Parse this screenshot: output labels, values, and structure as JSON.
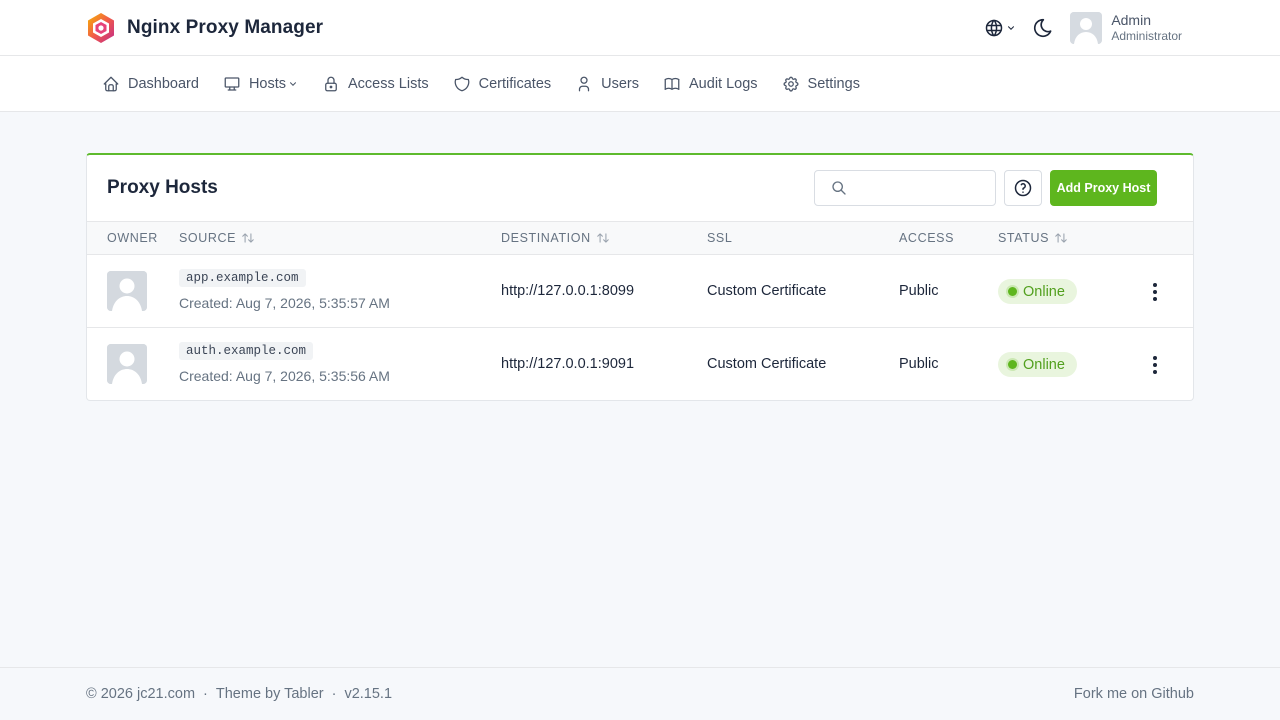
{
  "app": {
    "title": "Nginx Proxy Manager"
  },
  "user": {
    "name": "Admin",
    "role": "Administrator"
  },
  "nav": {
    "items": [
      {
        "label": "Dashboard",
        "icon": "home-icon"
      },
      {
        "label": "Hosts",
        "icon": "monitor-icon",
        "dropdown": true
      },
      {
        "label": "Access Lists",
        "icon": "lock-icon"
      },
      {
        "label": "Certificates",
        "icon": "shield-icon"
      },
      {
        "label": "Users",
        "icon": "user-icon"
      },
      {
        "label": "Audit Logs",
        "icon": "book-icon"
      },
      {
        "label": "Settings",
        "icon": "gear-icon"
      }
    ]
  },
  "card": {
    "title": "Proxy Hosts",
    "search_placeholder": "",
    "add_label": "Add Proxy Host",
    "accent_color": "#5eba2d"
  },
  "table": {
    "columns": {
      "owner": "OWNER",
      "source": "SOURCE",
      "destination": "DESTINATION",
      "ssl": "SSL",
      "access": "ACCESS",
      "status": "STATUS"
    },
    "rows": [
      {
        "domain": "app.example.com",
        "created": "Created: Aug 7, 2026, 5:35:57 AM",
        "destination": "http://127.0.0.1:8099",
        "ssl": "Custom Certificate",
        "access": "Public",
        "status": "Online"
      },
      {
        "domain": "auth.example.com",
        "created": "Created: Aug 7, 2026, 5:35:56 AM",
        "destination": "http://127.0.0.1:9091",
        "ssl": "Custom Certificate",
        "access": "Public",
        "status": "Online"
      }
    ]
  },
  "footer": {
    "copyright": "© 2026 jc21.com",
    "theme": "Theme by Tabler",
    "version": "v2.15.1",
    "fork": "Fork me on Github"
  },
  "colors": {
    "primary": "#5eb61e",
    "online": "#52a01e"
  }
}
